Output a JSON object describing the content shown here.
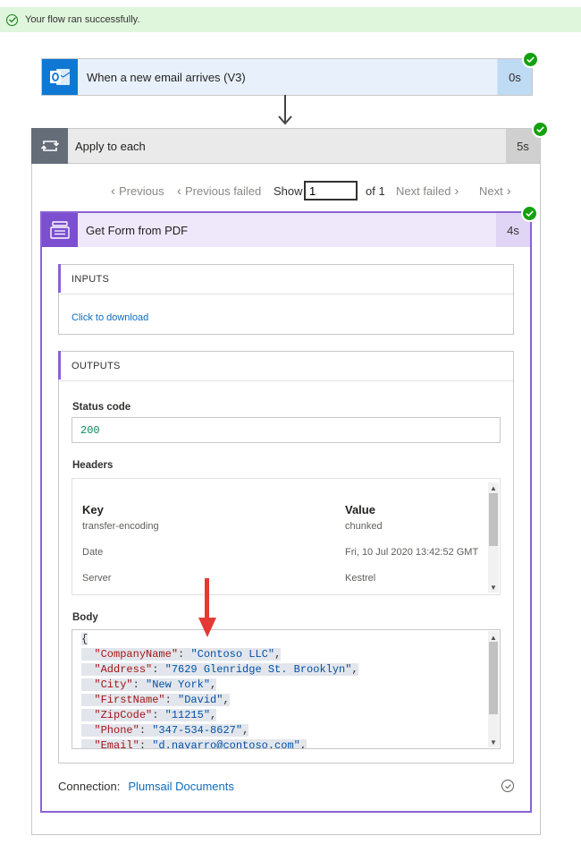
{
  "banner": {
    "text": "Your flow ran successfully."
  },
  "trigger": {
    "title": "When a new email arrives (V3)",
    "duration": "0s",
    "icon": "outlook-icon"
  },
  "apply_each": {
    "title": "Apply to each",
    "duration": "5s",
    "icon": "loop-icon"
  },
  "pager": {
    "previous": "Previous",
    "previous_failed": "Previous failed",
    "show_label": "Show",
    "current_value": "1",
    "of_label": "of 1",
    "next_failed": "Next failed",
    "next": "Next"
  },
  "action": {
    "title": "Get Form from PDF",
    "duration": "4s",
    "icon": "form-icon",
    "inputs": {
      "heading": "INPUTS",
      "download_link": "Click to download"
    },
    "outputs": {
      "heading": "OUTPUTS",
      "status_label": "Status code",
      "status_value": "200",
      "headers_label": "Headers",
      "headers_columns": {
        "key": "Key",
        "value": "Value"
      },
      "headers_rows": [
        {
          "key": "transfer-encoding",
          "value": "chunked"
        },
        {
          "key": "Date",
          "value": "Fri, 10 Jul 2020 13:42:52 GMT"
        },
        {
          "key": "Server",
          "value": "Kestrel"
        }
      ],
      "body_label": "Body",
      "body_lines": [
        {
          "text": "{"
        },
        {
          "key": "\"CompanyName\"",
          "value": "\"Contoso LLC\""
        },
        {
          "key": "\"Address\"",
          "value": "\"7629 Glenridge St. Brooklyn\""
        },
        {
          "key": "\"City\"",
          "value": "\"New York\""
        },
        {
          "key": "\"FirstName\"",
          "value": "\"David\""
        },
        {
          "key": "\"ZipCode\"",
          "value": "\"11215\""
        },
        {
          "key": "\"Phone\"",
          "value": "\"347-534-8627\""
        },
        {
          "key": "\"Email\"",
          "value": "\"d.navarro@contoso.com\""
        }
      ]
    },
    "connection": {
      "label": "Connection:",
      "value": "Plumsail Documents"
    }
  },
  "colors": {
    "success_bg": "#dff6dd",
    "outlook_blue": "#0f78d4",
    "loop_gray": "#646d78",
    "form_purple": "#7b4fcf",
    "card_border_purple": "#8a63d2",
    "link_blue": "#0f6cbd",
    "arrow_red": "#e53935",
    "check_green": "#13a10e"
  }
}
